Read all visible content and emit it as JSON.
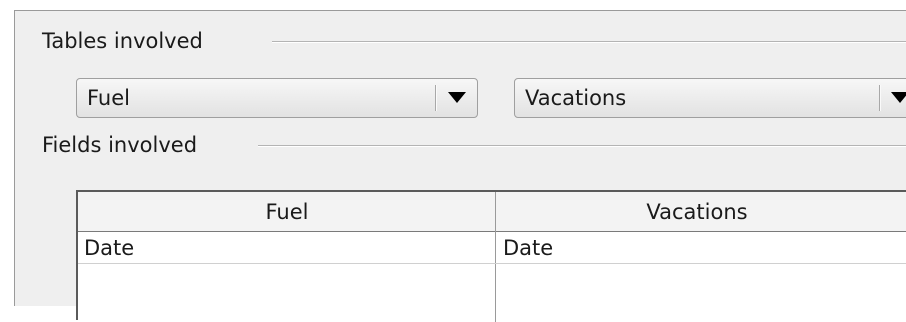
{
  "tables_section": {
    "title": "Tables involved",
    "left_table": {
      "selected": "Fuel"
    },
    "right_table": {
      "selected": "Vacations"
    }
  },
  "fields_section": {
    "title": "Fields involved",
    "columns": [
      "Fuel",
      "Vacations"
    ],
    "rows": [
      [
        "Date",
        "Date"
      ],
      [
        "",
        ""
      ]
    ]
  },
  "icons": {
    "dropdown": "triangle-down-icon"
  }
}
